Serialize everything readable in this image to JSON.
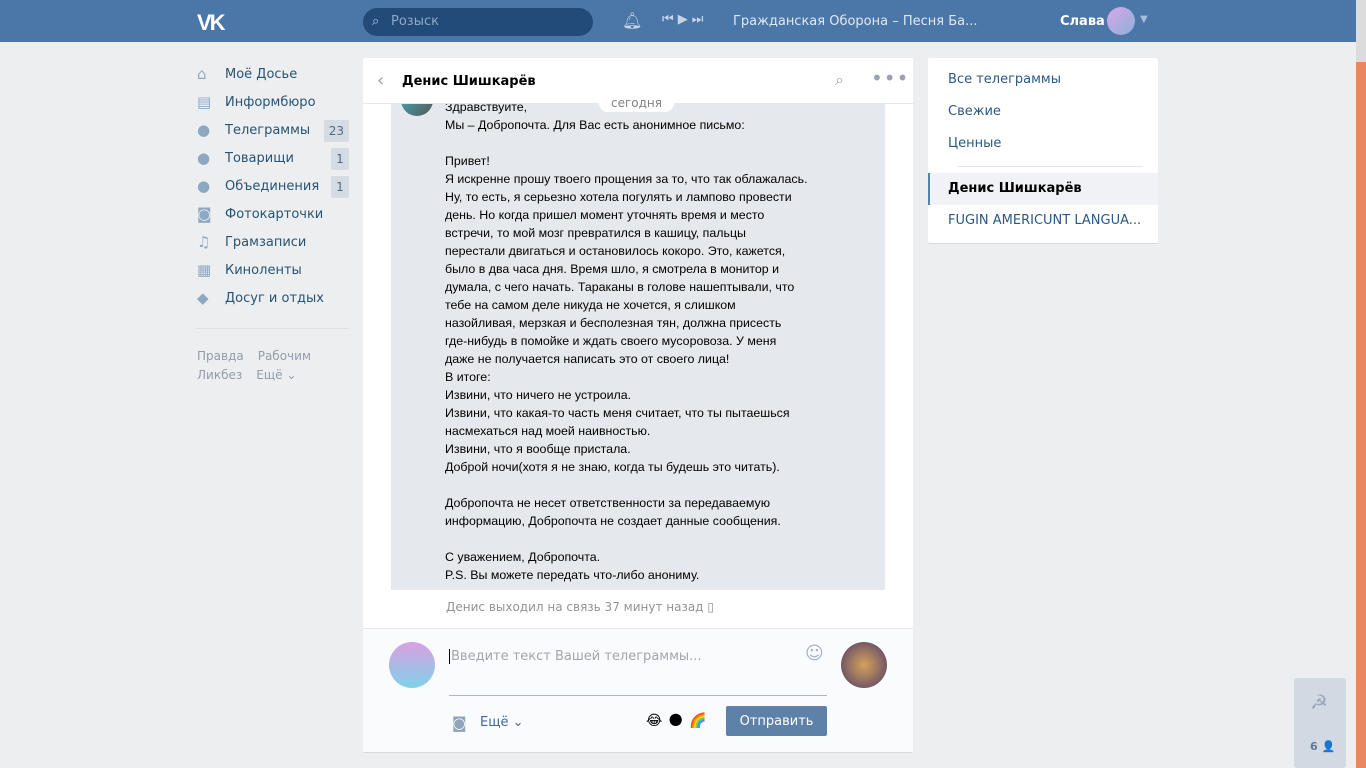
{
  "topbar": {
    "logo": "VK",
    "search_placeholder": "Розыск",
    "track": "Гражданская Оборона – Песня Ба...",
    "user_name": "Слава"
  },
  "sidebar": {
    "items": [
      {
        "label": "Моё Досье",
        "icon": "home-icon",
        "glyph": "⌂"
      },
      {
        "label": "Информбюро",
        "icon": "news-icon",
        "glyph": "▤"
      },
      {
        "label": "Телеграммы",
        "icon": "messages-icon",
        "glyph": "●",
        "badge": "23"
      },
      {
        "label": "Товарищи",
        "icon": "friends-icon",
        "glyph": "●",
        "badge": "1"
      },
      {
        "label": "Объединения",
        "icon": "groups-icon",
        "glyph": "●",
        "badge": "1"
      },
      {
        "label": "Фотокарточки",
        "icon": "camera-icon",
        "glyph": "◙"
      },
      {
        "label": "Грамзаписи",
        "icon": "music-icon",
        "glyph": "♫"
      },
      {
        "label": "Киноленты",
        "icon": "film-icon",
        "glyph": "▦"
      },
      {
        "label": "Досуг и отдых",
        "icon": "gamepad-icon",
        "glyph": "◆"
      }
    ],
    "footer": [
      "Правда",
      "Рабочим",
      "Ликбез",
      "Ещё ⌄"
    ]
  },
  "chat": {
    "title": "Денис Шишкарёв",
    "date": "сегодня",
    "message": "Здравствуйте,\nМы – Добропочта. Для Вас есть анонимное письмо:\n\nПривет!\nЯ искренне прошу твоего прощения за то, что так облажалась.\nНу, то есть, я серьезно хотела погулять и лампово провести\nдень. Но когда пришел момент уточнять время и место\nвстречи, то мой мозг превратился в кашицу, пальцы\nперестали двигаться и остановилось кокоро. Это, кажется,\nбыло в два часа дня. Время шло, я смотрела в монитор и\nдумала, с чего начать. Тараканы в голове нашептывали, что\nтебе на самом деле никуда не хочется, я слишком\nназойливая, мерзкая и бесполезная тян, должна присесть\nгде-нибудь в помойке и ждать своего мусоровоза. У меня\nдаже не получается написать это от своего лица!\nВ итоге:\nИзвини, что ничего не устроила.\nИзвини, что какая-то часть меня считает, что ты пытаешься\nнасмехаться над моей наивностью.\nИзвини, что я вообще пристала.\nДоброй ночи(хотя я не знаю, когда ты будешь это читать).\n\nДобропочта не несет ответственности за передаваемую\nинформацию, Добропочта не создает данные сообщения.\n\nС уважением, Добропочта.\nP.S. Вы можете передать что-либо анониму.",
    "status": "Денис выходил на связь 37 минут назад",
    "input_placeholder": "Введите текст Вашей телеграммы...",
    "more": "Ещё ⌄",
    "emoji": [
      "😂",
      "🌑",
      "🌈"
    ],
    "send": "Отправить"
  },
  "right": {
    "items": [
      "Все телеграммы",
      "Свежие",
      "Ценные"
    ],
    "dialogs": [
      "Денис Шишкарёв",
      "FUGIN AMERICUNT LANGUA..."
    ]
  },
  "widget": {
    "count": "6 👤"
  },
  "colors": {
    "header": "#4a76a8",
    "scroll_thumb": "#e88762",
    "send": "#5e81a8"
  }
}
